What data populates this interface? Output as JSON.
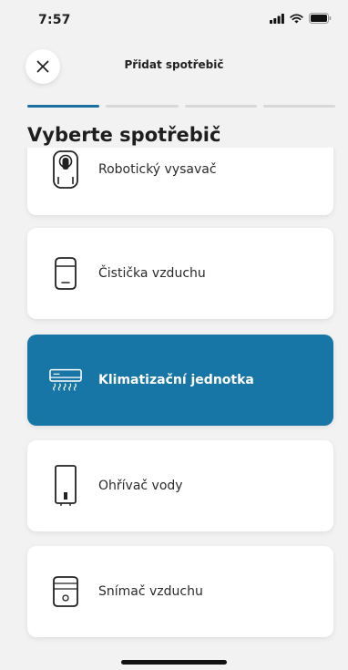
{
  "status_bar": {
    "time": "7:57"
  },
  "header": {
    "title": "Přidat spotřebič"
  },
  "progress": {
    "total_steps": 4,
    "current_step": 1
  },
  "section_title": "Vyberte spotřebič",
  "appliances": [
    {
      "label": "Robotický vysavač",
      "icon": "robot-vacuum-icon",
      "selected": false
    },
    {
      "label": "Čistička vzduchu",
      "icon": "air-purifier-icon",
      "selected": false
    },
    {
      "label": "Klimatizační jednotka",
      "icon": "air-conditioner-icon",
      "selected": true
    },
    {
      "label": "Ohřívač vody",
      "icon": "water-heater-icon",
      "selected": false
    },
    {
      "label": "Snímač vzduchu",
      "icon": "air-sensor-icon",
      "selected": false
    }
  ],
  "colors": {
    "accent": "#1776a6",
    "progress_active": "#1a6fa0",
    "background": "#f2f2f2"
  }
}
